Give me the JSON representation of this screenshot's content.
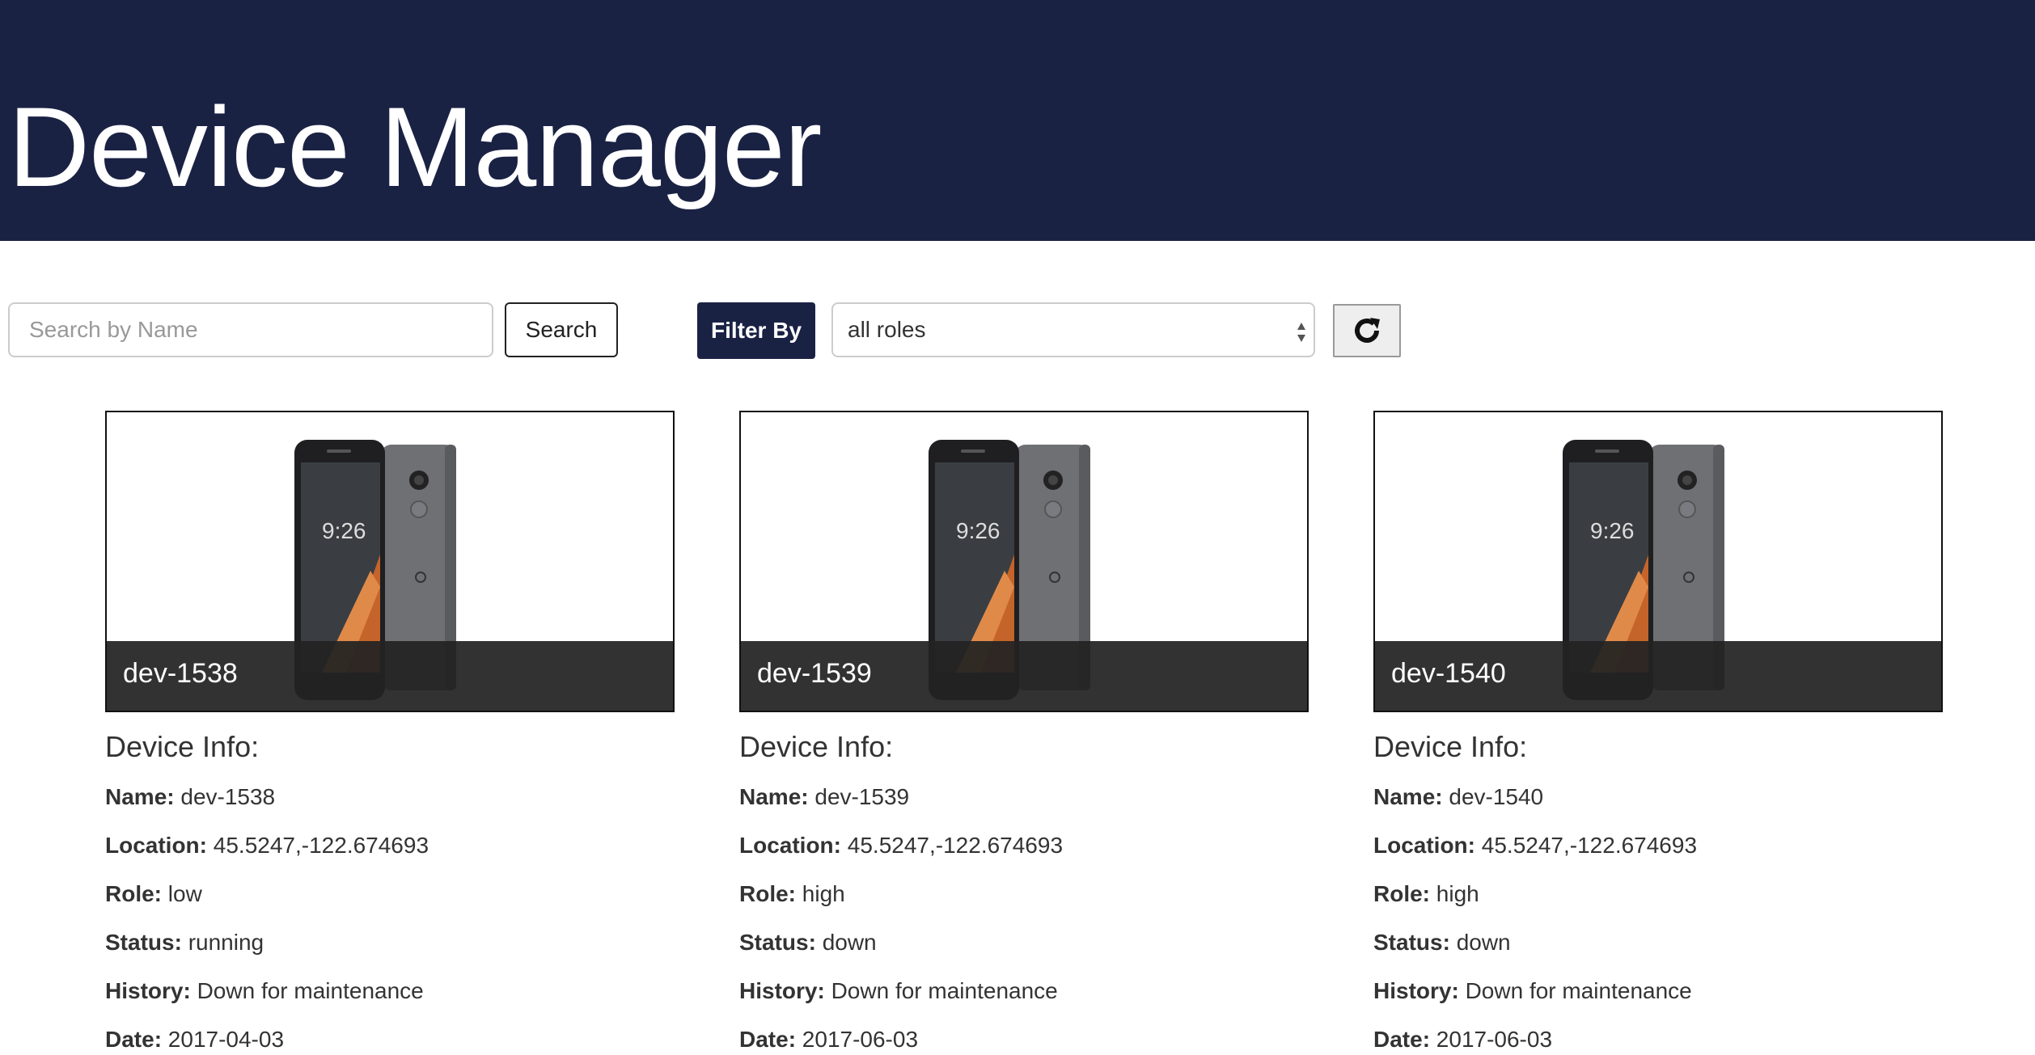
{
  "header": {
    "title": "Device Manager"
  },
  "toolbar": {
    "search_placeholder": "Search by Name",
    "search_button": "Search",
    "filter_label": "Filter By",
    "role_selected": "all roles",
    "refresh_icon": "refresh-icon"
  },
  "colors": {
    "header_bg": "#1a2244",
    "caption_bg": "#222222"
  },
  "info_labels": {
    "section": "Device Info:",
    "name": "Name:",
    "location": "Location:",
    "role": "Role:",
    "status": "Status:",
    "history": "History:",
    "date": "Date:"
  },
  "devices": [
    {
      "caption": "dev-1538",
      "name": "dev-1538",
      "location": "45.5247,-122.674693",
      "role": "low",
      "status": "running",
      "history": "Down for maintenance",
      "date": "2017-04-03"
    },
    {
      "caption": "dev-1539",
      "name": "dev-1539",
      "location": "45.5247,-122.674693",
      "role": "high",
      "status": "down",
      "history": "Down for maintenance",
      "date": "2017-06-03"
    },
    {
      "caption": "dev-1540",
      "name": "dev-1540",
      "location": "45.5247,-122.674693",
      "role": "high",
      "status": "down",
      "history": "Down for maintenance",
      "date": "2017-06-03"
    }
  ]
}
